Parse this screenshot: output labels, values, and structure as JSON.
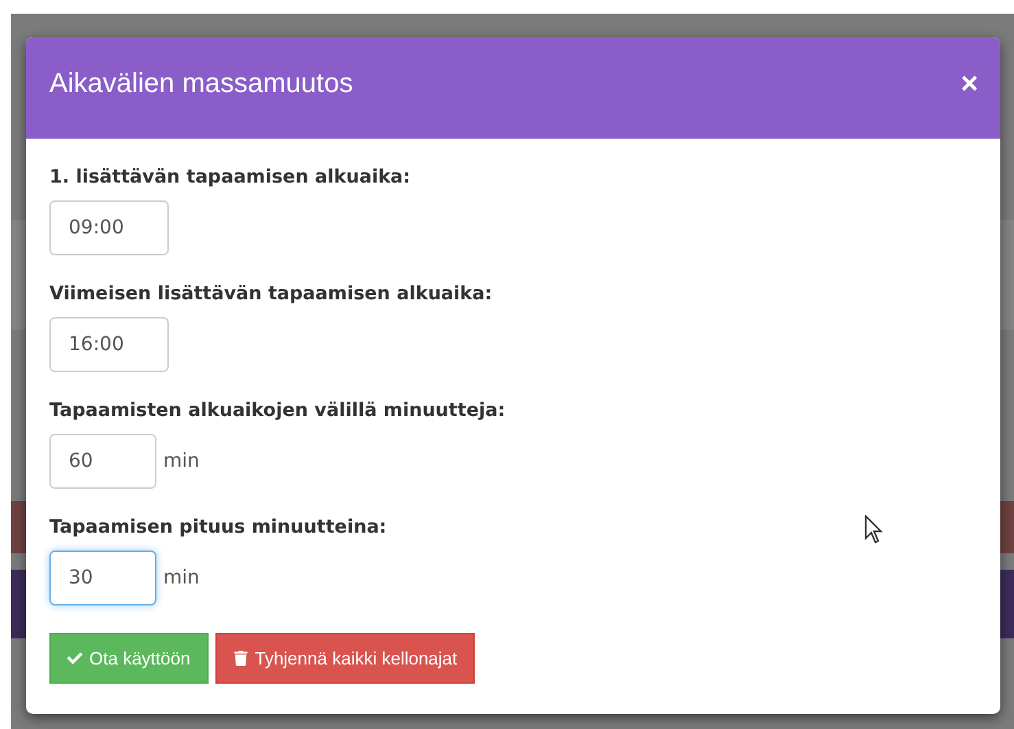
{
  "dialog": {
    "title": "Aikavälien massamuutos",
    "close": "×",
    "fields": [
      {
        "label": "1. lisättävän tapaamisen alkuaika:",
        "value": "09:00",
        "focused": false
      },
      {
        "label": "Viimeisen lisättävän tapaamisen alkuaika:",
        "value": "16:00",
        "focused": false
      },
      {
        "label": "Tapaamisten alkuaikojen välillä minuutteja:",
        "value": "60",
        "unit": "min",
        "focused": false
      },
      {
        "label": "Tapaamisen pituus minuutteina:",
        "value": "30",
        "unit": "min",
        "focused": true
      }
    ],
    "buttons": [
      {
        "label": "Ota käyttöön",
        "kind": "apply"
      },
      {
        "label": "Tyhjennä kaikki kellonajat",
        "kind": "clear"
      }
    ]
  }
}
